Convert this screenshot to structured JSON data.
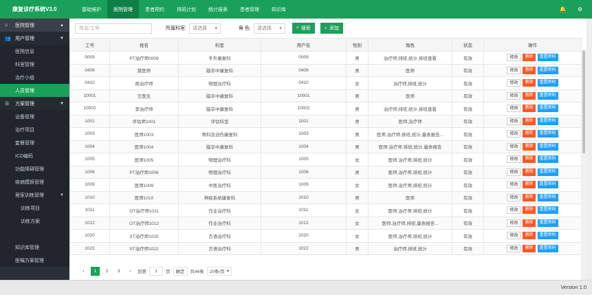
{
  "app": {
    "title": "康复诊疗系统V3.0"
  },
  "topnav": [
    {
      "label": "基础维护",
      "active": false
    },
    {
      "label": "医院管理",
      "active": true
    },
    {
      "label": "患者预约",
      "active": false
    },
    {
      "label": "排班计划",
      "active": false
    },
    {
      "label": "统计报表",
      "active": false
    },
    {
      "label": "患者管理",
      "active": false
    },
    {
      "label": "知识库",
      "active": false
    }
  ],
  "sidebar": {
    "items": [
      {
        "label": "医院管理",
        "type": "level1",
        "icon": "home-icon",
        "arrow": "caret-up"
      },
      {
        "label": "用户管理",
        "type": "group",
        "icon": "users-icon",
        "arrow": "caret-down"
      },
      {
        "label": "医院信息",
        "type": "sub"
      },
      {
        "label": "科室管理",
        "type": "sub"
      },
      {
        "label": "治疗小组",
        "type": "sub"
      },
      {
        "label": "人员管理",
        "type": "sub",
        "active": true
      },
      {
        "label": "方案管理",
        "type": "group",
        "icon": "list-icon",
        "arrow": "caret-down"
      },
      {
        "label": "设备管理",
        "type": "sub"
      },
      {
        "label": "治疗项目",
        "type": "sub"
      },
      {
        "label": "套餐管理",
        "type": "sub"
      },
      {
        "label": "ICD编码",
        "type": "sub"
      },
      {
        "label": "功能障碍管理",
        "type": "sub"
      },
      {
        "label": "疾病模板管理",
        "type": "sub"
      },
      {
        "label": "居家训练管理",
        "type": "sub",
        "arrow": "caret-down"
      },
      {
        "label": "训练项目",
        "type": "sub2"
      },
      {
        "label": "训练方案",
        "type": "sub2"
      },
      {
        "label": "",
        "type": "blank"
      },
      {
        "label": "知识库管理",
        "type": "sub"
      },
      {
        "label": "医嘱方案管理",
        "type": "sub"
      }
    ]
  },
  "toolbar": {
    "name_placeholder": "姓名/工号",
    "dept_label": "所属科室:",
    "dept_select": "请选择",
    "role_label": "角  色:",
    "role_select": "请选择",
    "search_label": "搜索",
    "add_label": "添加"
  },
  "table": {
    "headers": [
      "工号",
      "姓名",
      "科室",
      "用户名",
      "性别",
      "角色",
      "状态",
      "操作"
    ],
    "ops": {
      "edit": "修改",
      "del": "删除",
      "reset": "重置密码"
    },
    "rows": [
      {
        "id": "0009",
        "name": "PT治疗师0009",
        "dept": "手外康复科",
        "user": "0009",
        "sex": "男",
        "role": "治疗师,排班,统计,排班查看",
        "status": "有效"
      },
      {
        "id": "0409",
        "name": "莫医师",
        "dept": "脑卒中康复科",
        "user": "0409",
        "sex": "男",
        "role": "医师",
        "status": "有效"
      },
      {
        "id": "0410",
        "name": "周治疗师",
        "dept": "物理治疗科",
        "user": "0410",
        "sex": "女",
        "role": "治疗师,排班,统计",
        "status": "有效"
      },
      {
        "id": "10001",
        "name": "王医生",
        "dept": "脑卒中康复科",
        "user": "10001",
        "sex": "男",
        "role": "医师",
        "status": "有效"
      },
      {
        "id": "10002",
        "name": "李治疗师",
        "dept": "脑卒中康复科",
        "user": "10002",
        "sex": "男",
        "role": "治疗师,排班,统计,排班查看",
        "status": "有效"
      },
      {
        "id": "1001",
        "name": "评估师1001",
        "dept": "评估科室",
        "user": "1001",
        "sex": "男",
        "role": "医师,治疗师",
        "status": "有效"
      },
      {
        "id": "1003",
        "name": "医师1003",
        "dept": "骨科及创伤康复科",
        "user": "1003",
        "sex": "男",
        "role": "医师,治疗师,排班,统计,量表报告...",
        "status": "有效"
      },
      {
        "id": "1004",
        "name": "医师1004",
        "dept": "脑卒中康复科",
        "user": "1004",
        "sex": "男",
        "role": "医师,治疗师,排班,统计,量表报告",
        "status": "有效"
      },
      {
        "id": "1005",
        "name": "医师1005",
        "dept": "物理治疗科",
        "user": "1005",
        "sex": "女",
        "role": "医师,治疗师,排班,统计",
        "status": "有效"
      },
      {
        "id": "1006",
        "name": "PT治疗师1006",
        "dept": "物理治疗科",
        "user": "1006",
        "sex": "男",
        "role": "医师,治疗师,排班,统计",
        "status": "有效"
      },
      {
        "id": "1009",
        "name": "医师1009",
        "dept": "中医治疗科",
        "user": "1009",
        "sex": "女",
        "role": "医师,治疗师,排班,统计",
        "status": "有效"
      },
      {
        "id": "1010",
        "name": "医师1010",
        "dept": "神经系统康复科",
        "user": "1010",
        "sex": "男",
        "role": "医师",
        "status": "有效"
      },
      {
        "id": "1011",
        "name": "OT治疗师1011",
        "dept": "作业治疗科",
        "user": "1011",
        "sex": "女",
        "role": "医师,治疗师,排班,统计",
        "status": "有效"
      },
      {
        "id": "1012",
        "name": "OT治疗师1012",
        "dept": "作业治疗科",
        "user": "1012",
        "sex": "女",
        "role": "医师,治疗师,排班,量表报告...",
        "status": "有效"
      },
      {
        "id": "1020",
        "name": "ST治疗师1020",
        "dept": "言语治疗科",
        "user": "1020",
        "sex": "女",
        "role": "医师,治疗师,排班,统计",
        "status": "有效"
      },
      {
        "id": "1022",
        "name": "ST治疗师1022",
        "dept": "言语治疗科",
        "user": "1022",
        "sex": "男",
        "role": "治疗师,排班,统计",
        "status": "有效"
      }
    ]
  },
  "pager": {
    "pages": [
      "1",
      "2",
      "3"
    ],
    "prev": "‹",
    "next": "›",
    "goto_label": "到第",
    "goto_value": "1",
    "page_suffix": "页",
    "confirm": "确定",
    "total": "共46条",
    "size": "20条/页"
  },
  "footer": {
    "version": "Version 1.0"
  },
  "colors": {
    "brand": "#1aa05a",
    "danger": "#ff5722",
    "info": "#1e9fff",
    "sidebar": "#2b3038"
  },
  "icons": {
    "bell": "bell-icon",
    "gear": "gear-icon",
    "search": "search-icon",
    "add": "plus-icon"
  }
}
